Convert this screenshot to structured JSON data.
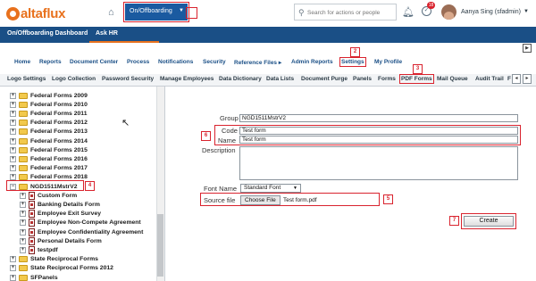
{
  "header": {
    "logo_text": "altaflux",
    "module_selector": "On/Offboarding",
    "search_placeholder": "Search for actions or people",
    "notification_badge": "18",
    "user_name": "Aanya Sing (sfadmin)"
  },
  "navbar": {
    "items": [
      "On/Offboarding Dashboard",
      "Ask HR"
    ]
  },
  "menu": {
    "items": [
      "Home",
      "Reports",
      "Document Center",
      "Process",
      "Notifications",
      "Security",
      "Reference Files ▸",
      "Admin Reports",
      "Settings",
      "My Profile"
    ]
  },
  "subtabs": {
    "items": [
      "Logo Settings",
      "Logo Collection",
      "Password Security",
      "Manage Employees",
      "Data Dictionary",
      "Data Lists",
      "Document Purge",
      "Panels",
      "Forms",
      "PDF Forms",
      "Mail Queue",
      "Audit Trail",
      "F"
    ]
  },
  "tree": {
    "rows": [
      {
        "label": "Federal Forms 2009",
        "kind": "folder"
      },
      {
        "label": "Federal Forms 2010",
        "kind": "folder"
      },
      {
        "label": "Federal Forms 2011",
        "kind": "folder"
      },
      {
        "label": "Federal Forms 2012",
        "kind": "folder"
      },
      {
        "label": "Federal Forms 2013",
        "kind": "folder"
      },
      {
        "label": "Federal Forms 2014",
        "kind": "folder"
      },
      {
        "label": "Federal Forms 2015",
        "kind": "folder"
      },
      {
        "label": "Federal Forms 2016",
        "kind": "folder"
      },
      {
        "label": "Federal Forms 2017",
        "kind": "folder"
      },
      {
        "label": "Federal Forms 2018",
        "kind": "folder"
      },
      {
        "label": "NGD1511MstrV2",
        "kind": "folder-open"
      },
      {
        "label": "Custom Form",
        "kind": "pdf"
      },
      {
        "label": "Banking Details Form",
        "kind": "pdf"
      },
      {
        "label": "Employee Exit Survey",
        "kind": "pdf"
      },
      {
        "label": "Employee Non-Compete Agreement",
        "kind": "pdf"
      },
      {
        "label": "Employee Confidentiality Agreement",
        "kind": "pdf"
      },
      {
        "label": "Personal Details Form",
        "kind": "pdf"
      },
      {
        "label": "testpdf",
        "kind": "pdf"
      },
      {
        "label": "State Reciprocal Forms",
        "kind": "folder"
      },
      {
        "label": "State Reciprocal Forms 2012",
        "kind": "folder"
      },
      {
        "label": "SFPanels",
        "kind": "folder"
      }
    ]
  },
  "form": {
    "group_label": "Group",
    "group_value": "NGD1511MstrV2",
    "code_label": "Code",
    "code_value": "Test form",
    "name_label": "Name",
    "name_value": "Test form",
    "description_label": "Description",
    "description_value": "",
    "font_label": "Font Name",
    "font_value": "Standard Font",
    "source_label": "Source file",
    "choose_file_label": "Choose File",
    "file_name": "Test form.pdf",
    "create_label": "Create"
  },
  "callouts": [
    "1",
    "2",
    "3",
    "4",
    "5",
    "6",
    "7"
  ],
  "colors": {
    "brand_orange": "#e8711d",
    "nav_blue": "#1a4f86",
    "module_blue": "#1a5aa0",
    "annotation_red": "#d9232e"
  }
}
